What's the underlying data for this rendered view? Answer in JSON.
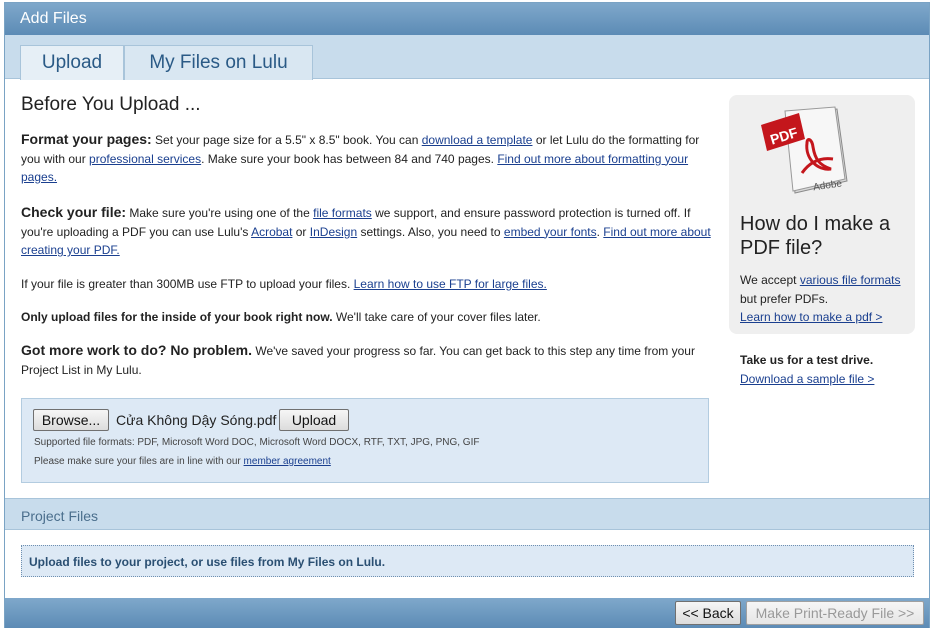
{
  "window": {
    "title": "Add Files"
  },
  "tabs": [
    {
      "label": "Upload"
    },
    {
      "label": "My Files on Lulu"
    }
  ],
  "main": {
    "heading": "Before You Upload ...",
    "format": {
      "lead": "Format your pages:",
      "t1": " Set your page size for a 5.5\" x 8.5\" book. You can ",
      "link1": "download a template",
      "t2": " or let Lulu do the formatting for you with our ",
      "link2": "professional services",
      "t3": ". Make sure your book has between 84 and 740 pages. ",
      "link3": "Find out more about formatting your pages."
    },
    "check": {
      "lead": "Check your file:",
      "t1": " Make sure you're using one of the ",
      "link1": "file formats",
      "t2": " we support, and ensure password protection is turned off. If you're uploading a PDF you can use Lulu's ",
      "link2": "Acrobat",
      "t3": " or ",
      "link3": "InDesign",
      "t4": " settings. Also, you need to ",
      "link4": "embed your fonts",
      "t5": ". ",
      "link5": "Find out more about creating your PDF."
    },
    "ftp": {
      "t1": "If your file is greater than 300MB use FTP to upload your files. ",
      "link1": "Learn how to use FTP for large files."
    },
    "inside": {
      "bold": "Only upload files for the inside of your book right now.",
      "t1": " We'll take care of your cover files later."
    },
    "more": {
      "lead": "Got more work to do? No problem.",
      "t1": " We've saved your progress so far. You can get back to this step any time from your Project List in My Lulu."
    }
  },
  "uploader": {
    "browse_label": "Browse...",
    "filename": "Cửa Không Dậy Sóng.pdf",
    "upload_label": "Upload",
    "formats_text": "Supported file formats: PDF, Microsoft Word DOC, Microsoft Word DOCX, RTF, TXT, JPG, PNG, GIF",
    "agreement_text": "Please make sure your files are in line with our ",
    "agreement_link": "member agreement"
  },
  "sidebar": {
    "icon": "pdf-adobe-icon",
    "icon_label": "PDF",
    "icon_brand": "Adobe",
    "heading": "How do I make a PDF file?",
    "t1": "We accept ",
    "link1": "various file formats",
    "t2": " but prefer PDFs.",
    "link2": "Learn how to make a pdf >"
  },
  "testdrive": {
    "bold": "Take us for a test drive.",
    "link": "Download a sample file >"
  },
  "project": {
    "title": "Project Files",
    "info": "Upload files to your project, or use files from My Files on Lulu."
  },
  "footer": {
    "back_label": "<< Back",
    "print_label": "Make Print-Ready File >>"
  },
  "colors": {
    "header": "#6d99c0",
    "link": "#1a3f8f",
    "tabstrip": "#c8dcec",
    "uploadbox": "#dde9f5"
  }
}
